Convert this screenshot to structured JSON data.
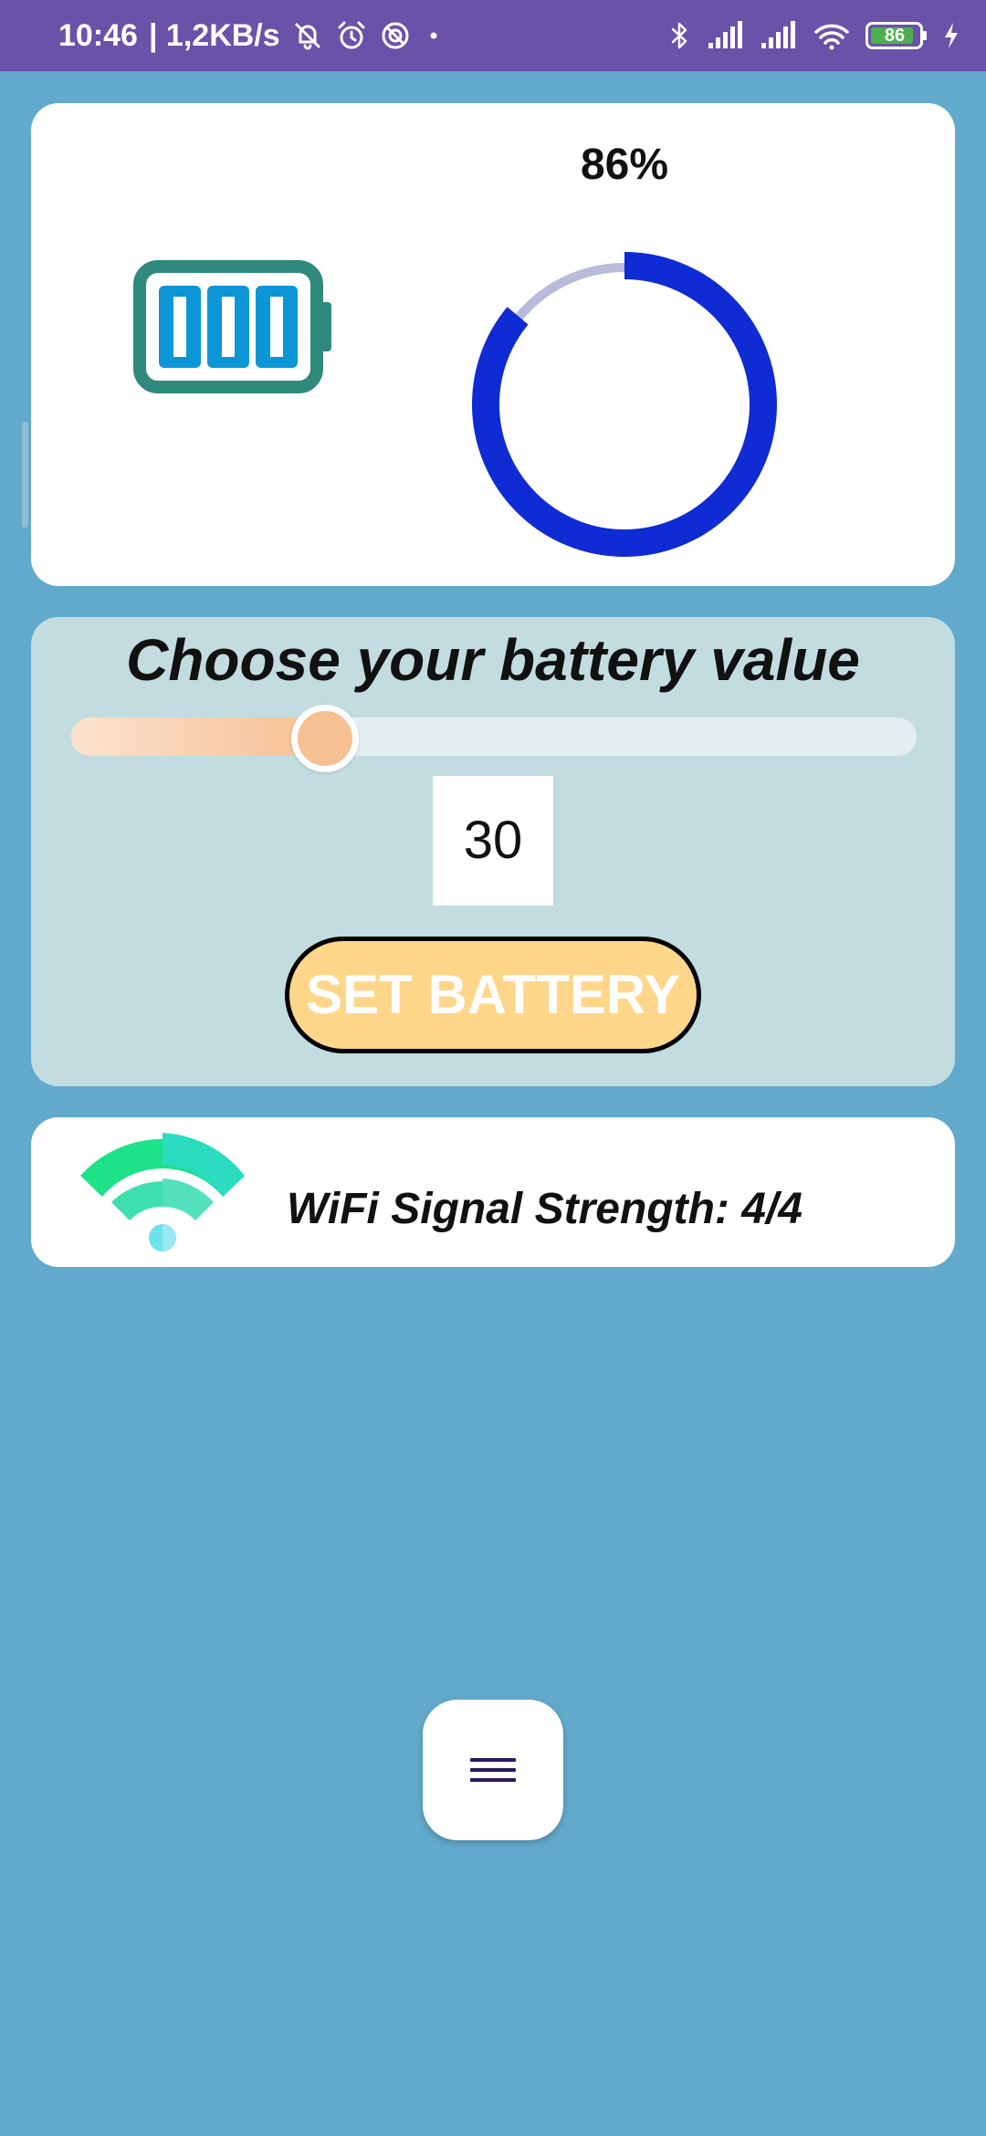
{
  "status_bar": {
    "time": "10:46",
    "network_speed": "| 1,2KB/s",
    "battery_level": "86",
    "icons": [
      "mute-icon",
      "alarm-icon",
      "do-not-disturb-icon",
      "notification-dot-icon",
      "bluetooth-icon",
      "signal-icon",
      "signal-icon",
      "wifi-icon",
      "battery-icon",
      "charging-icon"
    ]
  },
  "battery_card": {
    "percent_label": "86%",
    "level_percent": 86,
    "battery_icon": "battery-full-icon",
    "colors": {
      "ring_progress": "#0f2bd4",
      "ring_track": "#b8bbda",
      "battery_outline": "#2f8a7d",
      "battery_cells": "#0c96d6"
    }
  },
  "slider_card": {
    "title": "Choose your battery value",
    "slider_value": 30,
    "value_text": "30",
    "button_label": "SET BATTERY",
    "colors": {
      "button_bg": "#ffd68a",
      "slider_fill": "#f7c092"
    }
  },
  "wifi_card": {
    "icon": "wifi-icon",
    "text": "WiFi Signal Strength: 4/4"
  },
  "fab": {
    "icon": "menu-icon"
  },
  "colors": {
    "background": "#62aacc",
    "status_bar": "#6a52a8"
  }
}
